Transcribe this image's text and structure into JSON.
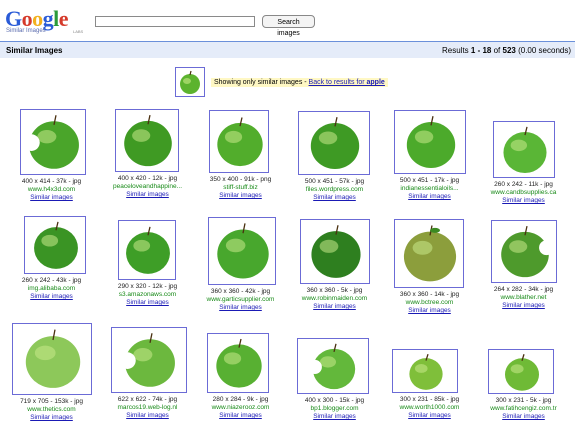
{
  "header": {
    "logo_text": "Google",
    "logo_subtitle": "Similar Images",
    "logo_labs": "LABS",
    "search_value": "",
    "search_button": "Search images"
  },
  "bar": {
    "title": "Similar Images",
    "results_prefix": "Results ",
    "results_range": "1 - 18",
    "results_of": " of ",
    "results_total": "523",
    "results_time": " (0.00 seconds)"
  },
  "notice": {
    "text": "Showing only similar images - ",
    "link": "Back to results for ",
    "query": "apple"
  },
  "colors": {
    "accent": "#6b6bd6",
    "site": "#178a17",
    "link": "#1a1ab5",
    "bar": "#e5ecf9"
  },
  "results": [
    {
      "meta": "400 x 414 - 37k - jpg",
      "site": "www.h4x3d.com",
      "similar": "Similar images"
    },
    {
      "meta": "400 x 420 - 12k - jpg",
      "site": "peaceloveandhappine...",
      "similar": "Similar images"
    },
    {
      "meta": "350 x 400 - 91k - png",
      "site": "stiff-stuff.biz",
      "similar": "Similar images"
    },
    {
      "meta": "500 x 451 - 57k - jpg",
      "site": "files.wordpress.com",
      "similar": "Similar images"
    },
    {
      "meta": "500 x 451 - 17k - jpg",
      "site": "indianessentialoils...",
      "similar": "Similar images"
    },
    {
      "meta": "260 x 242 - 11k - jpg",
      "site": "www.candbsupplies.ca",
      "similar": "Similar images"
    },
    {
      "meta": "260 x 242 - 43k - jpg",
      "site": "img.alibaba.com",
      "similar": "Similar images"
    },
    {
      "meta": "290 x 320 - 12k - jpg",
      "site": "s3.amazonaws.com",
      "similar": "Similar images"
    },
    {
      "meta": "360 x 360 - 42k - jpg",
      "site": "www.garticsupplier.com",
      "similar": "Similar images"
    },
    {
      "meta": "360 x 360 - 5k - jpg",
      "site": "www.robinmaiden.com",
      "similar": "Similar images"
    },
    {
      "meta": "360 x 360 - 14k - jpg",
      "site": "www.bctree.com",
      "similar": "Similar images"
    },
    {
      "meta": "264 x 282 - 34k - jpg",
      "site": "www.blather.net",
      "similar": "Similar images"
    },
    {
      "meta": "719 x 705 - 153k - jpg",
      "site": "www.thetics.com",
      "similar": "Similar images"
    },
    {
      "meta": "622 x 622 - 74k - jpg",
      "site": "marcos19.web-log.nl",
      "similar": "Similar images"
    },
    {
      "meta": "280 x 284 - 9k - jpg",
      "site": "www.niazerooz.com",
      "similar": "Similar images"
    },
    {
      "meta": "400 x 300 - 15k - jpg",
      "site": "bp1.blogger.com",
      "similar": "Similar images"
    },
    {
      "meta": "300 x 231 - 85k - jpg",
      "site": "www.worth1000.com",
      "similar": "Similar images"
    },
    {
      "meta": "300 x 231 - 5k - jpg",
      "site": "www.fatihcengiz.com.tr",
      "similar": "Similar images"
    }
  ]
}
